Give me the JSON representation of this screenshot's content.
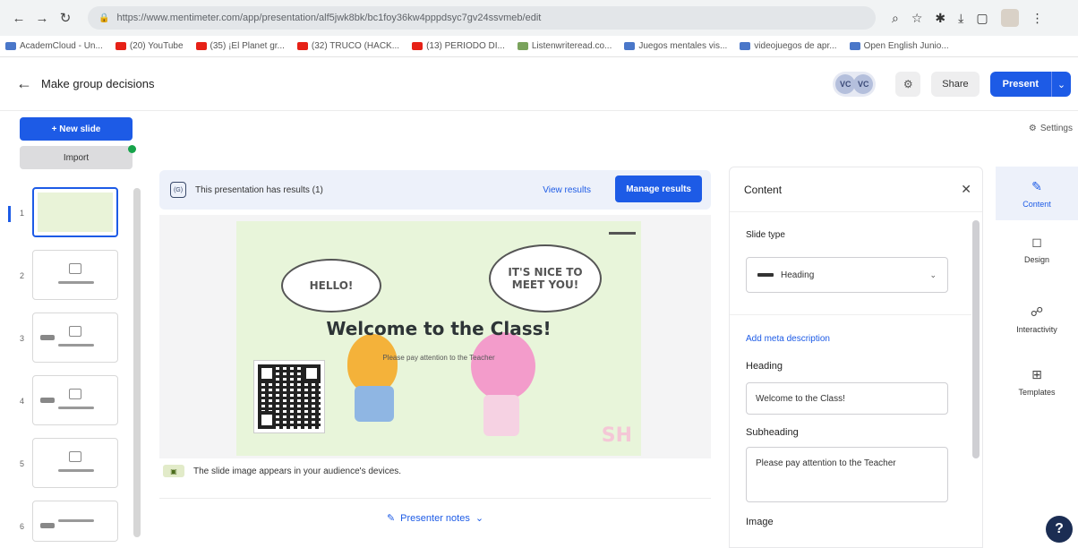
{
  "browser": {
    "url": "https://www.mentimeter.com/app/presentation/alf5jwk8bk/bc1foy36kw4pppdsyc7gv24ssvmeb/edit",
    "bookmarks": [
      {
        "label": "AcademCloud - Un...",
        "icon": "generic"
      },
      {
        "label": "(20) YouTube",
        "icon": "youtube"
      },
      {
        "label": "(35) ¡El Planet gr...",
        "icon": "youtube"
      },
      {
        "label": "(32) TRUCO (HACK...",
        "icon": "youtube"
      },
      {
        "label": "(13) PERIODO DI...",
        "icon": "youtube"
      },
      {
        "label": "Listenwriteread.co...",
        "icon": "generic"
      },
      {
        "label": "Juegos mentales vis...",
        "icon": "generic"
      },
      {
        "label": "videojuegos de apr...",
        "icon": "generic"
      },
      {
        "label": "Open English Junio...",
        "icon": "generic"
      }
    ]
  },
  "header": {
    "title": "Make group decisions",
    "avatars": [
      "VC",
      "VC"
    ],
    "share_label": "Share",
    "present_label": "Present",
    "settings_label": "Settings"
  },
  "rail": {
    "new_slide_label": "+ New slide",
    "import_label": "Import",
    "slides": [
      {
        "number": "1",
        "caption": ""
      },
      {
        "number": "2",
        "caption": ""
      },
      {
        "number": "3",
        "caption": ""
      },
      {
        "number": "4",
        "caption": ""
      },
      {
        "number": "5",
        "caption": ""
      },
      {
        "number": "6",
        "caption": ""
      }
    ]
  },
  "banner": {
    "icon_text": "(G)",
    "text": "This presentation has results (1)",
    "view_results_label": "View results",
    "manage_results_label": "Manage results"
  },
  "slide": {
    "bubble_left": "HELLO!",
    "bubble_right": "IT'S NICE TO MEET YOU!",
    "heading": "Welcome to the Class!",
    "subheading": "Please pay attention to the Teacher",
    "logo": "SH"
  },
  "slide_note": "The slide image appears in your audience's devices.",
  "presenter_notes_label": "Presenter notes",
  "panel": {
    "title": "Content",
    "slide_type_label": "Slide type",
    "slide_type_value": "Heading",
    "add_description": "Add meta description",
    "heading_label": "Heading",
    "heading_value": "Welcome to the Class!",
    "subheading_label": "Subheading",
    "subheading_value": "Please pay attention to the Teacher",
    "image_label": "Image"
  },
  "side_tabs": [
    {
      "label": "Content",
      "icon": "pencil-icon"
    },
    {
      "label": "Design",
      "icon": "paint-icon"
    },
    {
      "label": "Interactivity",
      "icon": "people-icon"
    },
    {
      "label": "Templates",
      "icon": "grid-icon"
    }
  ],
  "help_label": "?"
}
